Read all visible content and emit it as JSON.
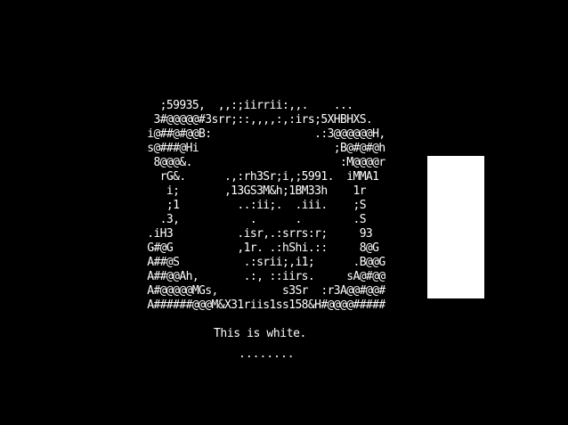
{
  "colors": {
    "background": "#000000",
    "foreground": "#ffffff",
    "box": "#ffffff"
  },
  "ascii_art": {
    "lines": [
      "   ;59935,  ,,:;iirrii:,,.    ...",
      "  3#@@@@@#3srr;::,,,,:,:irs;5XHBHXS.",
      " i@##@#@@B:                .:3@@@@@@H,",
      " s@###@Hi                     ;B@#@#@h",
      "  8@@@&.                       :M@@@@r",
      "   rG&.      .,:rh3Sr;i,;5991.  iMMA1",
      "    i;       ,13GS3M&h;1BM33h    1r",
      "    ;1         ..:ii;.  .iii.    ;S",
      "   .3,           .      .        .S",
      " .iH3          .isr,.:srrs:r;     93",
      " G#@G          ,1r. .:hShi.::     8@G",
      " A##@S          .:srii;,i1;      .B@@G",
      " A##@@Ah,       .:, ::iirs.     sA@#@@",
      " A#@@@@@MGs,          s3Sr  :r3A@@#@@#",
      " A######@@@M&X31riis1ss158&H#@@@@#####"
    ]
  },
  "caption": "This is white.",
  "progress_dots": "........"
}
